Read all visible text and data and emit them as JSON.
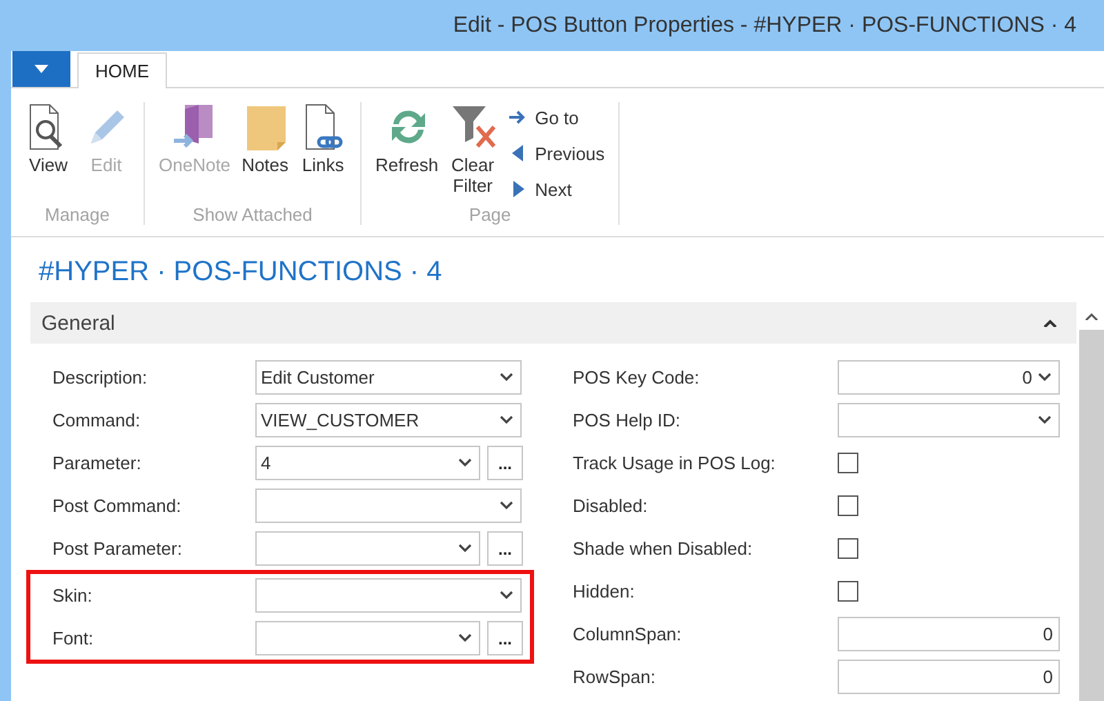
{
  "window": {
    "title": "Edit - POS Button Properties - #HYPER · POS-FUNCTIONS · 4"
  },
  "tabs": [
    {
      "label": "HOME",
      "selected": true
    }
  ],
  "ribbon": {
    "groups": [
      {
        "label": "Manage",
        "buttons": [
          {
            "label": "View",
            "disabled": false
          },
          {
            "label": "Edit",
            "disabled": true
          }
        ]
      },
      {
        "label": "Show Attached",
        "buttons": [
          {
            "label": "OneNote",
            "disabled": true
          },
          {
            "label": "Notes",
            "disabled": false
          },
          {
            "label": "Links",
            "disabled": false
          }
        ]
      },
      {
        "label": "Page",
        "buttons": [
          {
            "label": "Refresh",
            "disabled": false
          },
          {
            "label": "Clear Filter",
            "disabled": false
          }
        ],
        "small_buttons": [
          {
            "label": "Go to",
            "disabled": false
          },
          {
            "label": "Previous",
            "disabled": false
          },
          {
            "label": "Next",
            "disabled": false
          }
        ]
      }
    ]
  },
  "page_title": "#HYPER · POS-FUNCTIONS · 4",
  "section": {
    "title": "General",
    "expanded": true,
    "left_fields": [
      {
        "label": "Description:",
        "kind": "dropdown",
        "value": "Edit Customer",
        "highlighted": false
      },
      {
        "label": "Command:",
        "kind": "dropdown",
        "value": "VIEW_CUSTOMER",
        "highlighted": false
      },
      {
        "label": "Parameter:",
        "kind": "lookup",
        "value": "4",
        "button": "...",
        "highlighted": false
      },
      {
        "label": "Post Command:",
        "kind": "dropdown",
        "highlighted": false
      },
      {
        "label": "Post Parameter:",
        "kind": "lookup",
        "button": "...",
        "highlighted": false
      },
      {
        "label": "Skin:",
        "kind": "dropdown",
        "highlighted": true
      },
      {
        "label": "Font:",
        "kind": "lookup",
        "button": "...",
        "highlighted": true
      }
    ],
    "right_fields": [
      {
        "label": "POS Key Code:",
        "kind": "dropdown",
        "value": "0"
      },
      {
        "label": "POS Help ID:",
        "kind": "dropdown"
      },
      {
        "label": "Track Usage in POS Log:",
        "kind": "checkbox",
        "checked": false
      },
      {
        "label": "Disabled:",
        "kind": "checkbox",
        "checked": false
      },
      {
        "label": "Shade when Disabled:",
        "kind": "checkbox",
        "checked": false
      },
      {
        "label": "Hidden:",
        "kind": "checkbox",
        "checked": false
      },
      {
        "label": "ColumnSpan:",
        "kind": "number",
        "value": "0"
      },
      {
        "label": "RowSpan:",
        "kind": "number",
        "value": "0"
      }
    ]
  }
}
